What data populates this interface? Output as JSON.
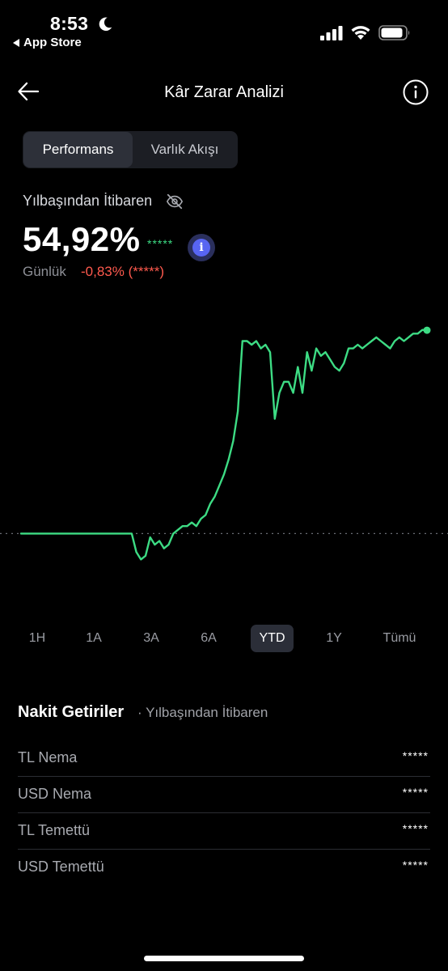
{
  "status_bar": {
    "time": "8:53",
    "back_app": "App Store",
    "icons": [
      "moon-icon",
      "signal-icon",
      "wifi-icon",
      "battery-icon"
    ]
  },
  "header": {
    "title": "Kâr Zarar Analizi",
    "icons": [
      "arrow-left-icon",
      "info-icon"
    ]
  },
  "segments": {
    "active": "Performans",
    "inactive": "Varlık Akışı"
  },
  "summary": {
    "label": "Yılbaşından İtibaren",
    "percent": "54,92%",
    "masked_value": "*****",
    "daily_label": "Günlük",
    "daily_value": "-0,83% (*****)"
  },
  "colors": {
    "line": "#3ddc84",
    "negative": "#ff5a4e",
    "accent": "#5865f2"
  },
  "chart_data": {
    "type": "line",
    "baseline_dashed": true,
    "y_unit": "%",
    "x_unit": "days since start of year",
    "x": [
      0,
      5,
      10,
      15,
      20,
      25,
      30,
      35,
      40,
      45,
      48,
      50,
      52,
      54,
      56,
      58,
      60,
      62,
      64,
      66,
      68,
      70,
      72,
      74,
      76,
      78,
      80,
      82,
      84,
      86,
      88,
      90,
      92,
      94,
      96,
      98,
      100,
      102,
      104,
      106,
      108,
      110,
      112,
      114,
      116,
      118,
      120,
      122,
      124,
      126,
      128,
      130,
      132,
      134,
      136,
      138,
      140,
      142,
      144,
      146,
      148,
      150,
      152,
      154,
      156,
      158,
      160,
      162,
      164,
      166,
      168,
      170,
      172,
      174,
      176
    ],
    "y": [
      0,
      0,
      0,
      0,
      0,
      0,
      0,
      0,
      0,
      0,
      0,
      -5,
      -7,
      -6,
      -1,
      -3,
      -2,
      -4,
      -3,
      0,
      1,
      2,
      2,
      3,
      2,
      4,
      5,
      8,
      10,
      13,
      16,
      20,
      25,
      33,
      52,
      52,
      51,
      52,
      50,
      51,
      49,
      31,
      38,
      41,
      41,
      38,
      45,
      38,
      49,
      44,
      50,
      48,
      49,
      47,
      45,
      44,
      46,
      50,
      50,
      51,
      50,
      51,
      52,
      53,
      52,
      51,
      50,
      52,
      53,
      52,
      53,
      54,
      54,
      55,
      54.92
    ]
  },
  "ranges": {
    "items": [
      "1H",
      "1A",
      "3A",
      "6A",
      "YTD",
      "1Y",
      "Tümü"
    ],
    "active": "YTD"
  },
  "cash_returns": {
    "title": "Nakit Getiriler",
    "subtitle": "· Yılbaşından İtibaren",
    "rows": [
      {
        "label": "TL Nema",
        "value": "*****"
      },
      {
        "label": "USD Nema",
        "value": "*****"
      },
      {
        "label": "TL Temettü",
        "value": "*****"
      },
      {
        "label": "USD Temettü",
        "value": "*****"
      }
    ]
  }
}
